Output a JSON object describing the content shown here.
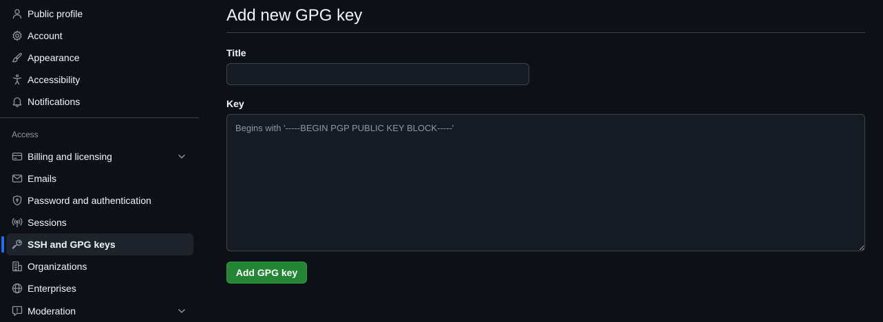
{
  "sidebar": {
    "items_top": [
      {
        "label": "Public profile",
        "icon": "person-icon"
      },
      {
        "label": "Account",
        "icon": "gear-icon"
      },
      {
        "label": "Appearance",
        "icon": "paintbrush-icon"
      },
      {
        "label": "Accessibility",
        "icon": "accessibility-icon"
      },
      {
        "label": "Notifications",
        "icon": "bell-icon"
      }
    ],
    "section_heading": "Access",
    "items_access": [
      {
        "label": "Billing and licensing",
        "icon": "credit-card-icon",
        "expandable": true
      },
      {
        "label": "Emails",
        "icon": "mail-icon"
      },
      {
        "label": "Password and authentication",
        "icon": "shield-lock-icon"
      },
      {
        "label": "Sessions",
        "icon": "broadcast-icon"
      },
      {
        "label": "SSH and GPG keys",
        "icon": "key-icon",
        "active": true
      },
      {
        "label": "Organizations",
        "icon": "organization-icon"
      },
      {
        "label": "Enterprises",
        "icon": "globe-icon"
      },
      {
        "label": "Moderation",
        "icon": "report-icon",
        "expandable": true
      }
    ]
  },
  "main": {
    "page_title": "Add new GPG key",
    "title_label": "Title",
    "title_value": "",
    "key_label": "Key",
    "key_placeholder": "Begins with '-----BEGIN PGP PUBLIC KEY BLOCK-----'",
    "key_value": "",
    "submit_label": "Add GPG key"
  },
  "colors": {
    "background": "#0d1117",
    "input_background": "#151b23",
    "border": "#3d444d",
    "text": "#f0f6fc",
    "muted_text": "#9198a1",
    "active_item_background": "#1f242c",
    "active_indicator": "#1f6feb",
    "primary_button": "#238636"
  }
}
